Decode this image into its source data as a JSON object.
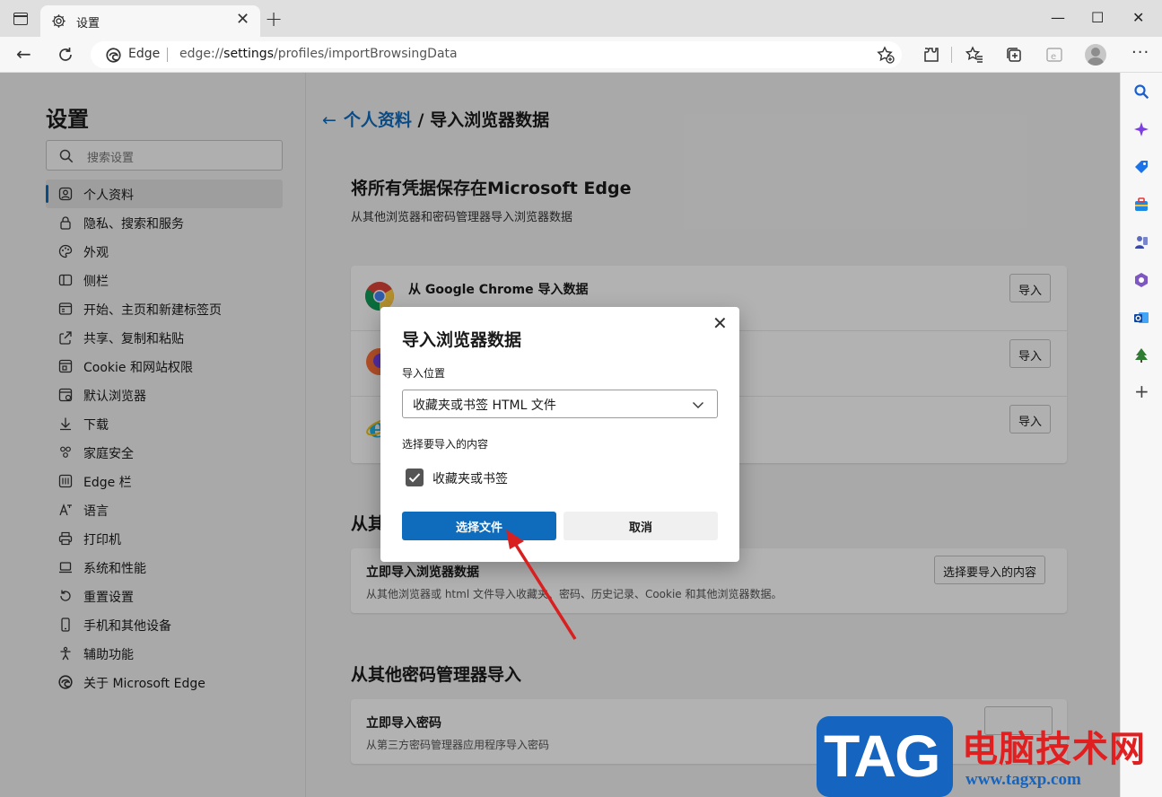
{
  "window": {
    "tab_title": "设置",
    "tab_close": "✕",
    "new_tab": "+",
    "controls": {
      "minimize": "—",
      "maximize": "☐",
      "close": "✕"
    }
  },
  "address": {
    "site_label": "Edge",
    "url_prefix": "edge://",
    "url_highlight": "settings",
    "url_rest": "/profiles/importBrowsingData"
  },
  "sidebar": {
    "title": "设置",
    "search_placeholder": "搜索设置",
    "items": [
      {
        "label": "个人资料",
        "icon": "profile-icon",
        "active": true
      },
      {
        "label": "隐私、搜索和服务",
        "icon": "lock-icon"
      },
      {
        "label": "外观",
        "icon": "palette-icon"
      },
      {
        "label": "侧栏",
        "icon": "sidebar-icon"
      },
      {
        "label": "开始、主页和新建标签页",
        "icon": "home-tab-icon"
      },
      {
        "label": "共享、复制和粘贴",
        "icon": "share-icon"
      },
      {
        "label": "Cookie 和网站权限",
        "icon": "cookie-icon"
      },
      {
        "label": "默认浏览器",
        "icon": "browser-icon"
      },
      {
        "label": "下载",
        "icon": "download-icon"
      },
      {
        "label": "家庭安全",
        "icon": "family-icon"
      },
      {
        "label": "Edge 栏",
        "icon": "edge-bar-icon"
      },
      {
        "label": "语言",
        "icon": "language-icon"
      },
      {
        "label": "打印机",
        "icon": "printer-icon"
      },
      {
        "label": "系统和性能",
        "icon": "laptop-icon"
      },
      {
        "label": "重置设置",
        "icon": "reset-icon"
      },
      {
        "label": "手机和其他设备",
        "icon": "phone-icon"
      },
      {
        "label": "辅助功能",
        "icon": "accessibility-icon"
      },
      {
        "label": "关于 Microsoft Edge",
        "icon": "edge-logo-icon"
      }
    ]
  },
  "main": {
    "breadcrumb_parent": "个人资料",
    "breadcrumb_sep": " / ",
    "breadcrumb_current": "导入浏览器数据",
    "section1": {
      "title": "将所有凭据保存在Microsoft Edge",
      "subtitle": "从其他浏览器和密码管理器导入浏览器数据",
      "rows": [
        {
          "title": "从 Google Chrome 导入数据",
          "button": "导入",
          "icon": "chrome-icon"
        },
        {
          "title": "",
          "button": "导入",
          "icon": "firefox-icon"
        },
        {
          "title": "",
          "button": "导入",
          "icon": "ie-icon"
        }
      ]
    },
    "section2": {
      "title": "从其",
      "row_title": "立即导入浏览器数据",
      "row_sub": "从其他浏览器或 html 文件导入收藏夹、密码、历史记录、Cookie 和其他浏览器数据。",
      "button": "选择要导入的内容"
    },
    "section3": {
      "title": "从其他密码管理器导入",
      "row_title": "立即导入密码",
      "row_sub": "从第三方密码管理器应用程序导入密码"
    }
  },
  "dialog": {
    "title": "导入浏览器数据",
    "close": "✕",
    "location_label": "导入位置",
    "location_value": "收藏夹或书签 HTML 文件",
    "content_label": "选择要导入的内容",
    "checkbox_label": "收藏夹或书签",
    "checkbox_checked": true,
    "primary_button": "选择文件",
    "cancel_button": "取消",
    "accent_color": "#0f6cbd"
  },
  "watermark": {
    "logo_text": "TAG",
    "cn_text": "电脑技术网",
    "url": "www.tagxp.com"
  }
}
